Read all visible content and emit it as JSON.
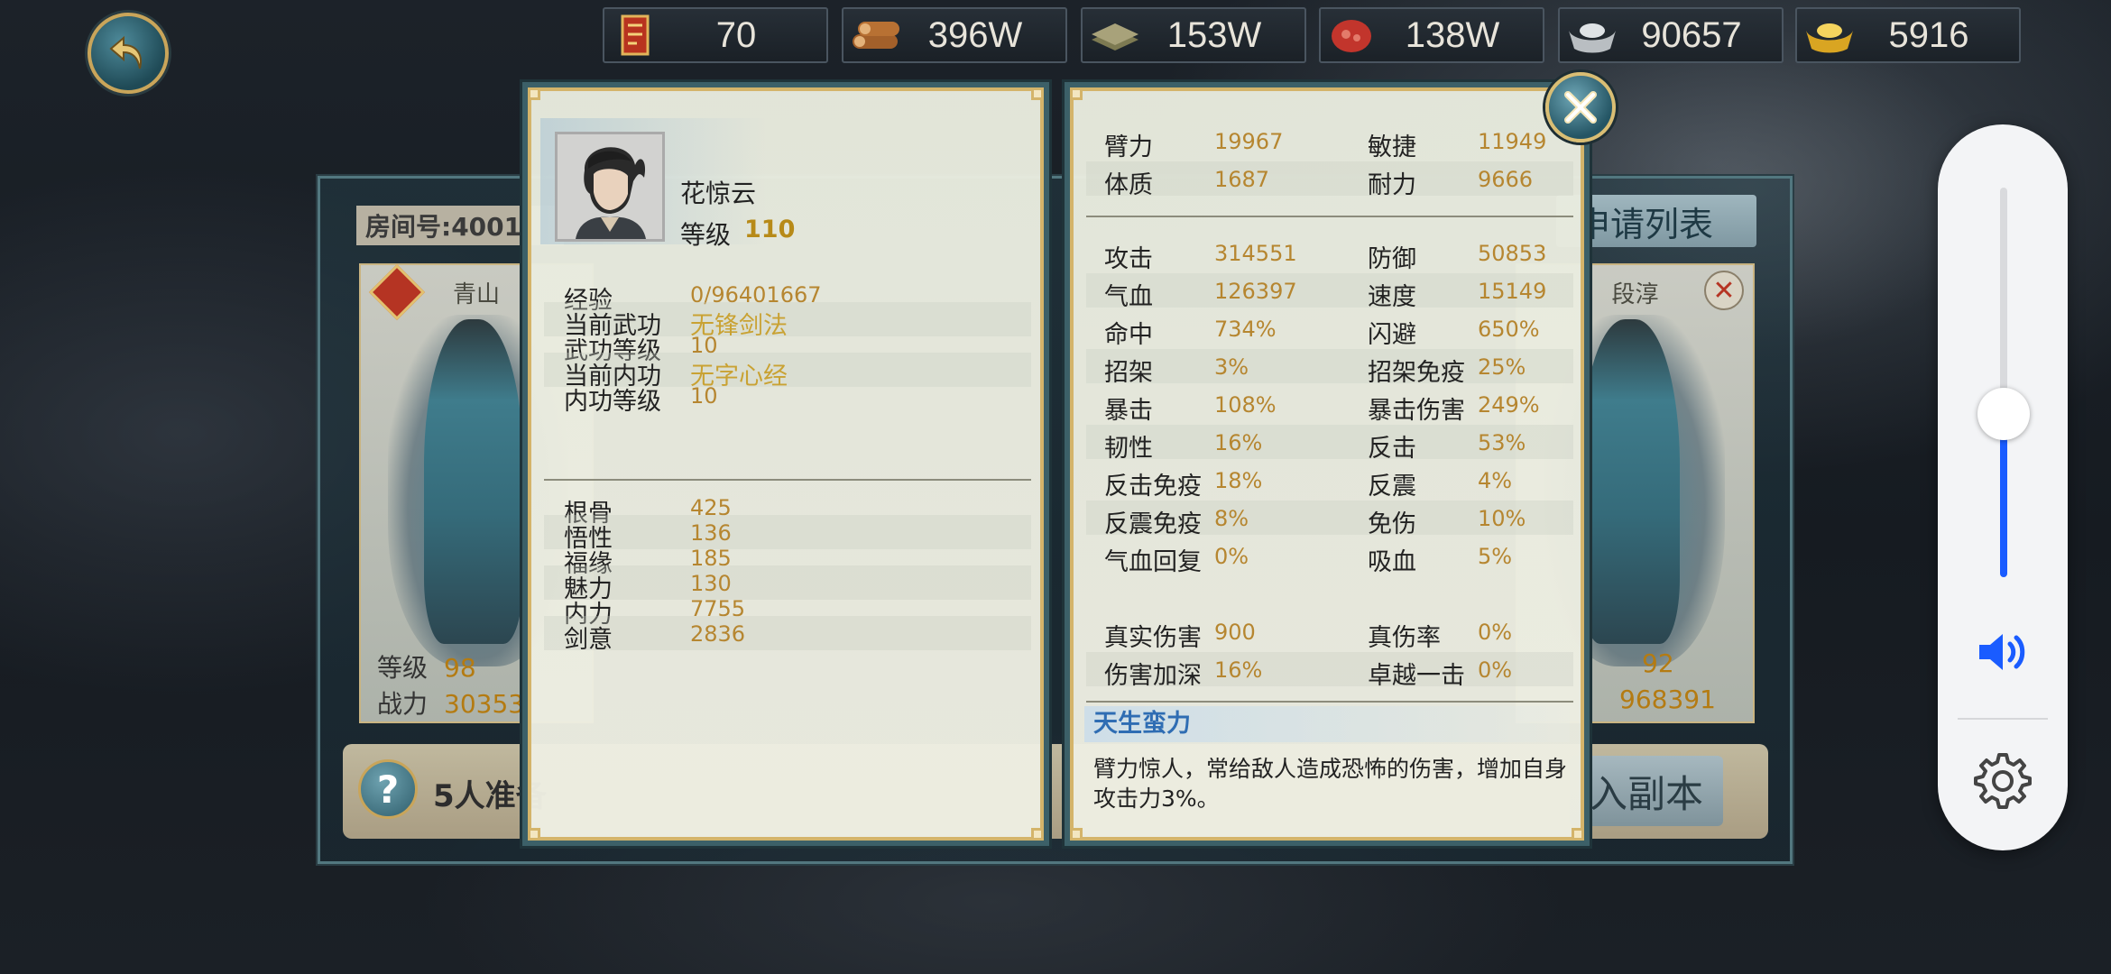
{
  "resources": [
    {
      "icon": "token-icon",
      "value": "70"
    },
    {
      "icon": "wood-icon",
      "value": "396W"
    },
    {
      "icon": "book-icon",
      "value": "153W"
    },
    {
      "icon": "meat-icon",
      "value": "138W"
    },
    {
      "icon": "silver-ingot-icon",
      "value": "90657"
    },
    {
      "icon": "gold-ingot-icon",
      "value": "5916"
    }
  ],
  "team": {
    "room_label": "房间号:4001",
    "apply_list": "申请列表",
    "left_card": {
      "name": "青山",
      "level_label": "等级",
      "level": "98",
      "power_label": "战力",
      "power": "30353"
    },
    "right_card": {
      "name": "段淳",
      "level": "92",
      "power": "968391"
    },
    "help_text": "5人准备",
    "enter_label": "入副本"
  },
  "hero": {
    "name": "花惊云",
    "level_label": "等级",
    "level": "110",
    "info": [
      {
        "label": "经验",
        "value": "0/96401667"
      },
      {
        "label": "当前武功",
        "value": "无锋剑法",
        "gold": true
      },
      {
        "label": "武功等级",
        "value": "10"
      },
      {
        "label": "当前内功",
        "value": "无字心经",
        "gold": true
      },
      {
        "label": "内功等级",
        "value": "10"
      }
    ],
    "attributes": [
      {
        "label": "根骨",
        "value": "425"
      },
      {
        "label": "悟性",
        "value": "136"
      },
      {
        "label": "福缘",
        "value": "185"
      },
      {
        "label": "魅力",
        "value": "130"
      },
      {
        "label": "内力",
        "value": "7755"
      },
      {
        "label": "剑意",
        "value": "2836"
      }
    ]
  },
  "stats": {
    "base": [
      [
        {
          "label": "臂力",
          "value": "19967"
        },
        {
          "label": "敏捷",
          "value": "11949"
        }
      ],
      [
        {
          "label": "体质",
          "value": "1687"
        },
        {
          "label": "耐力",
          "value": "9666"
        }
      ]
    ],
    "combat": [
      [
        {
          "label": "攻击",
          "value": "314551"
        },
        {
          "label": "防御",
          "value": "50853"
        }
      ],
      [
        {
          "label": "气血",
          "value": "126397"
        },
        {
          "label": "速度",
          "value": "15149"
        }
      ],
      [
        {
          "label": "命中",
          "value": "734%"
        },
        {
          "label": "闪避",
          "value": "650%"
        }
      ],
      [
        {
          "label": "招架",
          "value": "3%"
        },
        {
          "label": "招架免疫",
          "value": "25%"
        }
      ],
      [
        {
          "label": "暴击",
          "value": "108%"
        },
        {
          "label": "暴击伤害",
          "value": "249%"
        }
      ],
      [
        {
          "label": "韧性",
          "value": "16%"
        },
        {
          "label": "反击",
          "value": "53%"
        }
      ],
      [
        {
          "label": "反击免疫",
          "value": "18%"
        },
        {
          "label": "反震",
          "value": "4%"
        }
      ],
      [
        {
          "label": "反震免疫",
          "value": "8%"
        },
        {
          "label": "免伤",
          "value": "10%"
        }
      ],
      [
        {
          "label": "气血回复",
          "value": "0%"
        },
        {
          "label": "吸血",
          "value": "5%"
        }
      ]
    ],
    "extra": [
      [
        {
          "label": "真实伤害",
          "value": "900"
        },
        {
          "label": "真伤率",
          "value": "0%"
        }
      ],
      [
        {
          "label": "伤害加深",
          "value": "16%"
        },
        {
          "label": "卓越一击",
          "value": "0%"
        }
      ]
    ],
    "talent_title": "天生蛮力",
    "talent_desc": "臂力惊人，常给敌人造成恐怖的伤害，增加自身攻击力3%。"
  },
  "volume": {
    "level": 0.42,
    "accent": "#1a5cff"
  },
  "colors": {
    "value_gold": "#b68630",
    "frame_gold": "#d4b46a",
    "frame_teal": "#3c6068"
  }
}
